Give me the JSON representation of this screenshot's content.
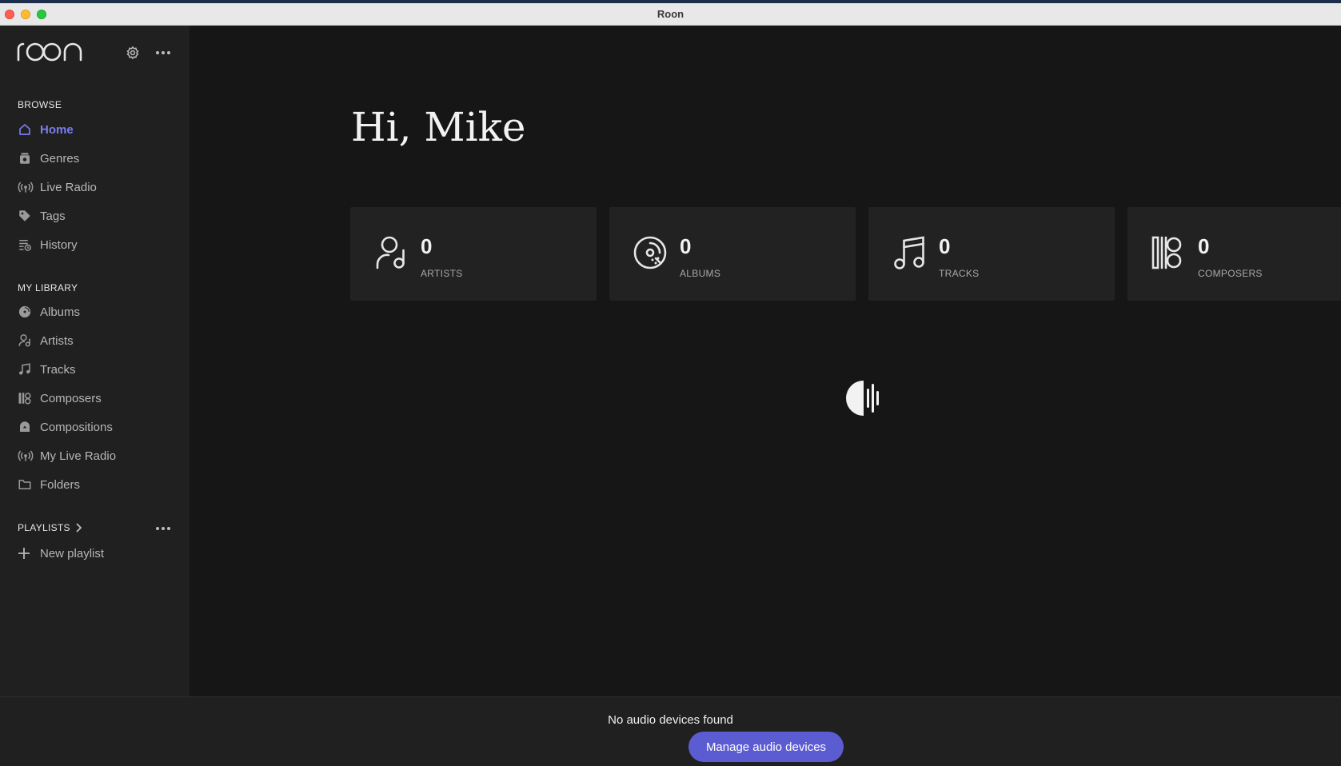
{
  "window": {
    "title": "Roon"
  },
  "sidebar": {
    "browse_header": "BROWSE",
    "browse": [
      {
        "label": "Home",
        "icon": "home-icon",
        "active": true
      },
      {
        "label": "Genres",
        "icon": "genres-icon"
      },
      {
        "label": "Live Radio",
        "icon": "radio-icon"
      },
      {
        "label": "Tags",
        "icon": "tag-icon"
      },
      {
        "label": "History",
        "icon": "history-icon"
      }
    ],
    "library_header": "MY LIBRARY",
    "library": [
      {
        "label": "Albums",
        "icon": "album-icon"
      },
      {
        "label": "Artists",
        "icon": "artist-icon"
      },
      {
        "label": "Tracks",
        "icon": "music-note-icon"
      },
      {
        "label": "Composers",
        "icon": "composer-icon"
      },
      {
        "label": "Compositions",
        "icon": "composition-icon"
      },
      {
        "label": "My Live Radio",
        "icon": "radio-icon"
      },
      {
        "label": "Folders",
        "icon": "folder-icon"
      }
    ],
    "playlists_header": "PLAYLISTS",
    "new_playlist": "New playlist"
  },
  "main": {
    "greeting": "Hi, Mike",
    "stats": [
      {
        "count": "0",
        "label": "ARTISTS",
        "icon": "artist-icon"
      },
      {
        "count": "0",
        "label": "ALBUMS",
        "icon": "album-icon"
      },
      {
        "count": "0",
        "label": "TRACKS",
        "icon": "music-note-icon"
      },
      {
        "count": "0",
        "label": "COMPOSERS",
        "icon": "composer-icon"
      }
    ]
  },
  "footer": {
    "status": "No audio devices found",
    "manage_label": "Manage audio devices"
  },
  "colors": {
    "accent": "#7b7cf0",
    "button": "#5c5cd2",
    "background": "#161616",
    "sidebar": "#202020"
  }
}
